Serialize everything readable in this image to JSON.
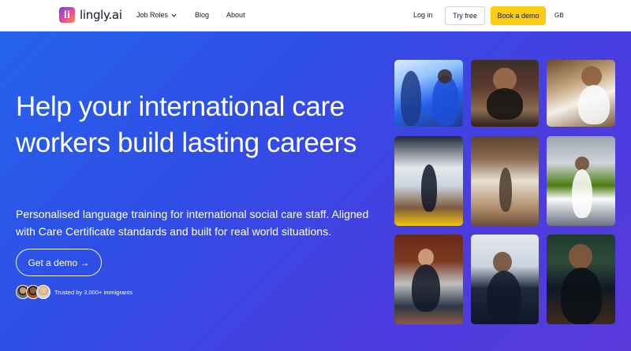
{
  "nav": {
    "logo_mark": "li",
    "logo_text": "lingly.ai",
    "links": [
      {
        "label": "Job Roles",
        "has_dropdown": true
      },
      {
        "label": "Blog"
      },
      {
        "label": "About"
      }
    ],
    "login": "Log in",
    "try_free": "Try free",
    "book_demo": "Book a demo",
    "language": "GB"
  },
  "hero": {
    "headline": "Help your international care workers build lasting careers",
    "subheadline": "Personalised language training for international social care staff. Aligned with Care Certificate standards and built for real world situations.",
    "cta": "Get a demo →",
    "trust_text": "Trusted by 3,000+ immigrants"
  },
  "colors": {
    "accent_yellow": "#facc15",
    "hero_gradient_start": "#2563eb",
    "hero_gradient_end": "#5a3ad9"
  },
  "photos": [
    {
      "subject": "care-worker-with-patient-photo"
    },
    {
      "subject": "chef-in-kitchen-photo"
    },
    {
      "subject": "worker-with-young-person-photo"
    },
    {
      "subject": "carer-with-child-in-garden-photo"
    },
    {
      "subject": "cleaner-mopping-hallway-photo"
    },
    {
      "subject": "nurse-in-white-uniform-photo"
    },
    {
      "subject": "elderly-man-at-door-photo"
    },
    {
      "subject": "flight-attendant-photo"
    },
    {
      "subject": "waiter-smiling-photo"
    }
  ]
}
